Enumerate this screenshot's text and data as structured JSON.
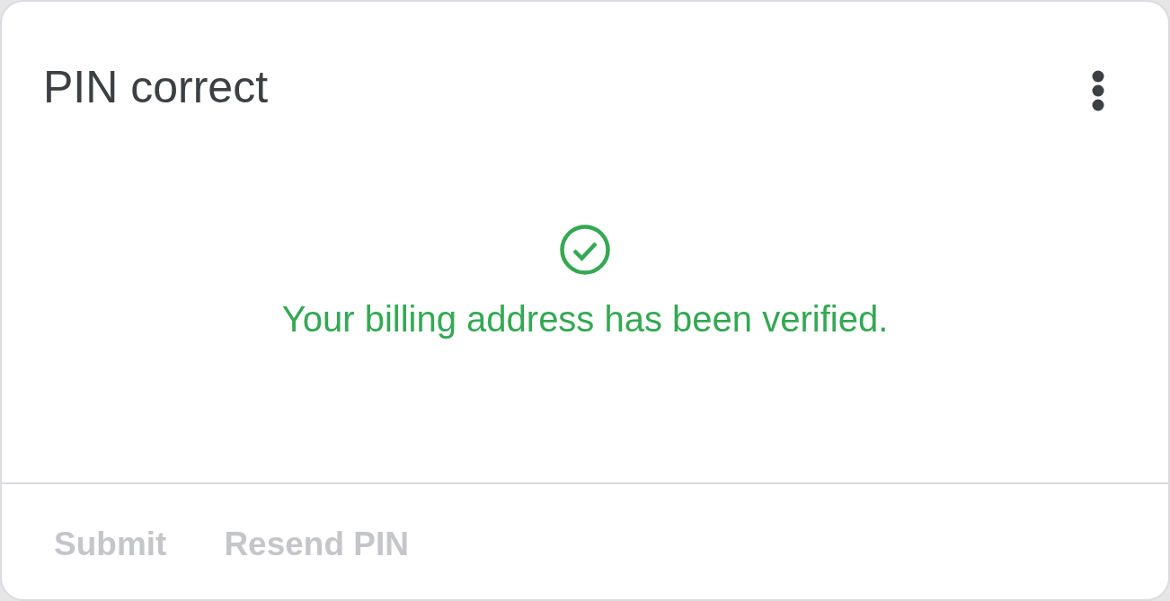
{
  "card": {
    "title": "PIN correct"
  },
  "status": {
    "kind": "success",
    "message": "Your billing address has been verified."
  },
  "actions": [
    {
      "label": "Submit",
      "disabled": true
    },
    {
      "label": "Resend PIN",
      "disabled": true
    }
  ]
}
